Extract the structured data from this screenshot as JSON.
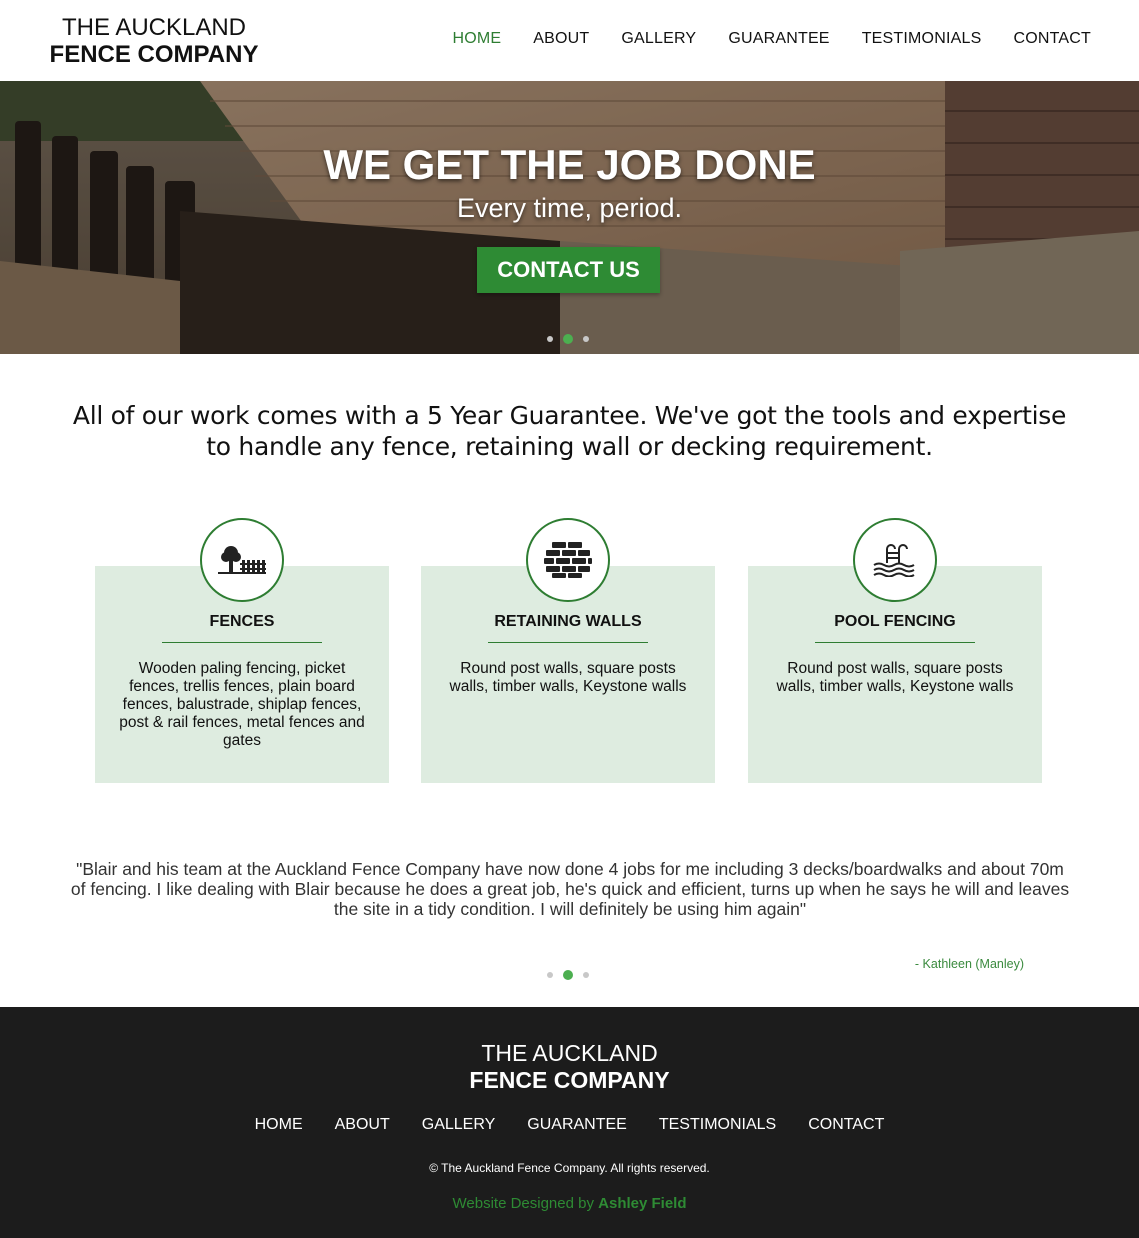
{
  "header": {
    "logo_line1": "THE AUCKLAND",
    "logo_line2": "FENCE COMPANY",
    "nav": [
      "HOME",
      "ABOUT",
      "GALLERY",
      "GUARANTEE",
      "TESTIMONIALS",
      "CONTACT"
    ],
    "active_nav": "HOME"
  },
  "hero": {
    "title": "WE GET THE JOB DONE",
    "subtitle": "Every time, period.",
    "cta_label": "CONTACT US",
    "slide_count": 3,
    "active_slide": 2
  },
  "intro": {
    "text": "All of our work comes with a 5 Year Guarantee. We've got the tools and expertise to handle any fence, retaining wall or decking requirement."
  },
  "services": [
    {
      "icon": "fence-icon",
      "title": "FENCES",
      "description": "Wooden paling fencing, picket fences, trellis fences, plain board fences, balustrade, shiplap fences, post & rail fences, metal fences and gates"
    },
    {
      "icon": "brick-wall-icon",
      "title": "RETAINING WALLS",
      "description": "Round post walls, square posts walls, timber walls, Keystone walls"
    },
    {
      "icon": "pool-ladder-icon",
      "title": "POOL FENCING",
      "description": "Round post walls, square posts walls, timber walls, Keystone walls"
    }
  ],
  "testimonial": {
    "quote": "\"Blair and his team at the Auckland Fence Company have now done 4 jobs for me including 3 decks/boardwalks and about 70m of fencing. I like dealing with Blair because he does a great job, he's quick and efficient, turns up when he says he will and leaves the site in a tidy condition. I will definitely be using him again\"",
    "author": "- Kathleen (Manley)",
    "slide_count": 3,
    "active_slide": 2
  },
  "footer": {
    "logo_line1": "THE AUCKLAND",
    "logo_line2": "FENCE COMPANY",
    "nav": [
      "HOME",
      "ABOUT",
      "GALLERY",
      "GUARANTEE",
      "TESTIMONIALS",
      "CONTACT"
    ],
    "copyright": "© The Auckland Fence Company. All rights reserved.",
    "credit_prefix": "Website Designed by ",
    "credit_name": "Ashley Field"
  },
  "colors": {
    "accent": "#2e7d32",
    "button": "#2e8b34",
    "card_bg": "#deece0",
    "footer_bg": "#1c1c1c",
    "dot_active": "#4caf50"
  }
}
